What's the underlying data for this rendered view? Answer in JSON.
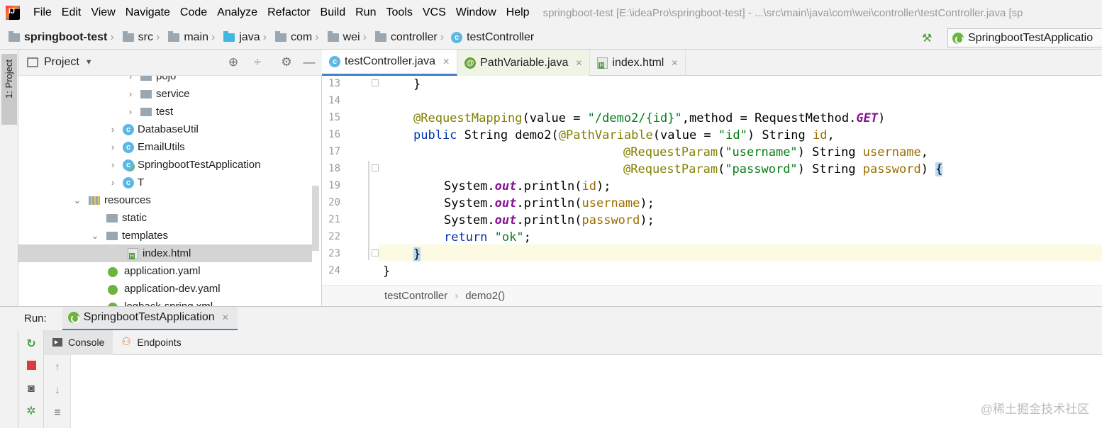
{
  "menubar": {
    "items": [
      "File",
      "Edit",
      "View",
      "Navigate",
      "Code",
      "Analyze",
      "Refactor",
      "Build",
      "Run",
      "Tools",
      "VCS",
      "Window",
      "Help"
    ],
    "window_title": "springboot-test [E:\\ideaPro\\springboot-test] - ...\\src\\main\\java\\com\\wei\\controller\\testController.java [sp"
  },
  "navbar": {
    "project": "springboot-test",
    "crumbs": [
      "src",
      "main",
      "java",
      "com",
      "wei",
      "controller"
    ],
    "current_class": "testController",
    "run_config": "SpringbootTestApplicatio"
  },
  "left_stripe": {
    "project_tab": "1: Project"
  },
  "project_panel": {
    "title": "Project",
    "tree": [
      {
        "label": "pojo",
        "icon": "package-folder-icon",
        "arrow": "›"
      },
      {
        "label": "service",
        "icon": "package-folder-icon",
        "arrow": "›"
      },
      {
        "label": "test",
        "icon": "package-folder-icon",
        "arrow": "›"
      },
      {
        "label": "DatabaseUtil",
        "icon": "class-icon",
        "arrow": "›"
      },
      {
        "label": "EmailUtils",
        "icon": "class-icon",
        "arrow": "›"
      },
      {
        "label": "SpringbootTestApplication",
        "icon": "spring-class-icon",
        "arrow": "›"
      },
      {
        "label": "T",
        "icon": "class-icon",
        "arrow": "›"
      },
      {
        "label": "resources",
        "icon": "resources-folder-icon",
        "arrow": "⌄"
      },
      {
        "label": "static",
        "icon": "folder-icon",
        "arrow": ""
      },
      {
        "label": "templates",
        "icon": "folder-icon",
        "arrow": "⌄"
      },
      {
        "label": "index.html",
        "icon": "html-file-icon",
        "arrow": ""
      },
      {
        "label": "application.yaml",
        "icon": "yaml-file-icon",
        "arrow": ""
      },
      {
        "label": "application-dev.yaml",
        "icon": "yaml-file-icon",
        "arrow": ""
      },
      {
        "label": "logback-spring.xml",
        "icon": "xml-file-icon",
        "arrow": ""
      }
    ]
  },
  "editor_tabs": [
    {
      "label": "testController.java",
      "icon": "class-icon",
      "active": true
    },
    {
      "label": "PathVariable.java",
      "icon": "annotation-icon",
      "active": false
    },
    {
      "label": "index.html",
      "icon": "html-file-icon",
      "active": false
    }
  ],
  "editor": {
    "line_numbers": [
      "13",
      "14",
      "15",
      "16",
      "17",
      "18",
      "19",
      "20",
      "21",
      "22",
      "23",
      "24"
    ],
    "code": {
      "l13_brace": "}",
      "l15_ann": "@RequestMapping",
      "l15_a": "(value = ",
      "l15_str": "\"/demo2/{id}\"",
      "l15_b": ",method = RequestMethod.",
      "l15_get": "GET",
      "l15_c": ")",
      "l16_kw": "public",
      "l16_a": " String demo2(",
      "l16_ann": "@PathVariable",
      "l16_b": "(value = ",
      "l16_str": "\"id\"",
      "l16_c": ") String ",
      "l16_par": "id",
      "l16_d": ",",
      "l17_ann": "@RequestParam",
      "l17_a": "(",
      "l17_str": "\"username\"",
      "l17_b": ") String ",
      "l17_par": "username",
      "l17_c": ",",
      "l18_ann": "@RequestParam",
      "l18_a": "(",
      "l18_str": "\"password\"",
      "l18_b": ") String ",
      "l18_par": "password",
      "l18_c": ") ",
      "l18_brace": "{",
      "sys": "System.",
      "out": "out",
      "println": ".println(",
      "l19_par": "id",
      "l20_par": "username",
      "l21_par": "password",
      "close": ");",
      "l22_kw": "return",
      "l22_str": "\"ok\"",
      "l22_end": ";",
      "l23_brace": "}",
      "l24_brace": "}"
    },
    "breadcrumb": [
      "testController",
      "demo2()"
    ]
  },
  "run_panel": {
    "label": "Run:",
    "tab": "SpringbootTestApplication",
    "console_tabs": [
      "Console",
      "Endpoints"
    ]
  },
  "watermark": "@稀土掘金技术社区"
}
